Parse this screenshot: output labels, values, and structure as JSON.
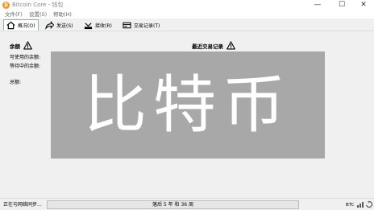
{
  "window": {
    "title": "Bitcoin Core - 钱包",
    "minimize": "—",
    "maximize": "☐",
    "close": "✕"
  },
  "menu": [
    "文件(F)",
    "设置(S)",
    "帮助(H)"
  ],
  "tabs": [
    {
      "label": "概况(O)",
      "icon": "home-icon",
      "active": true
    },
    {
      "label": "发送(S)",
      "icon": "send-arrow-icon",
      "active": false
    },
    {
      "label": "接收(R)",
      "icon": "receive-icon",
      "active": false
    },
    {
      "label": "交易记录(T)",
      "icon": "transactions-icon",
      "active": false
    }
  ],
  "overview": {
    "balance_heading": "余额",
    "available": "可使用的余额:",
    "pending": "等待中的余额:",
    "total": "总额:",
    "recent_heading": "最近交易记录"
  },
  "overlay": {
    "text": "比特币"
  },
  "status": {
    "sync_text": "正在与网络同步...",
    "progress_text": "落后 5 年 和 36 周",
    "unit": "BTC",
    "progress_fraction": 0
  },
  "colors": {
    "accent": "#f7931a",
    "warning": "#000000"
  }
}
